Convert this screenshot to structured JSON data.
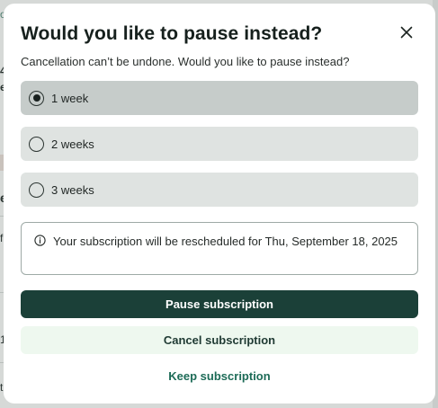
{
  "dialog": {
    "title": "Would you like to pause instead?",
    "subtitle": "Cancellation can’t be undone. Would you like to pause instead?",
    "options": [
      {
        "label": "1 week",
        "selected": true
      },
      {
        "label": "2 weeks",
        "selected": false
      },
      {
        "label": "3 weeks",
        "selected": false
      }
    ],
    "notice": "Your subscription will be rescheduled for Thu, September 18, 2025",
    "buttons": {
      "pause": "Pause subscription",
      "cancel": "Cancel subscription",
      "keep": "Keep subscription"
    }
  },
  "background_fragments": [
    "o",
    "4",
    "e",
    "e",
    "f",
    "1",
    "t"
  ],
  "colors": {
    "primary": "#1b4038",
    "secondary_bg": "#eef8ef",
    "link": "#1d6b57",
    "option_bg": "#dfe3e1",
    "option_selected_bg": "#c6ccca"
  },
  "icons": {
    "close": "close-icon",
    "info": "info-icon"
  }
}
